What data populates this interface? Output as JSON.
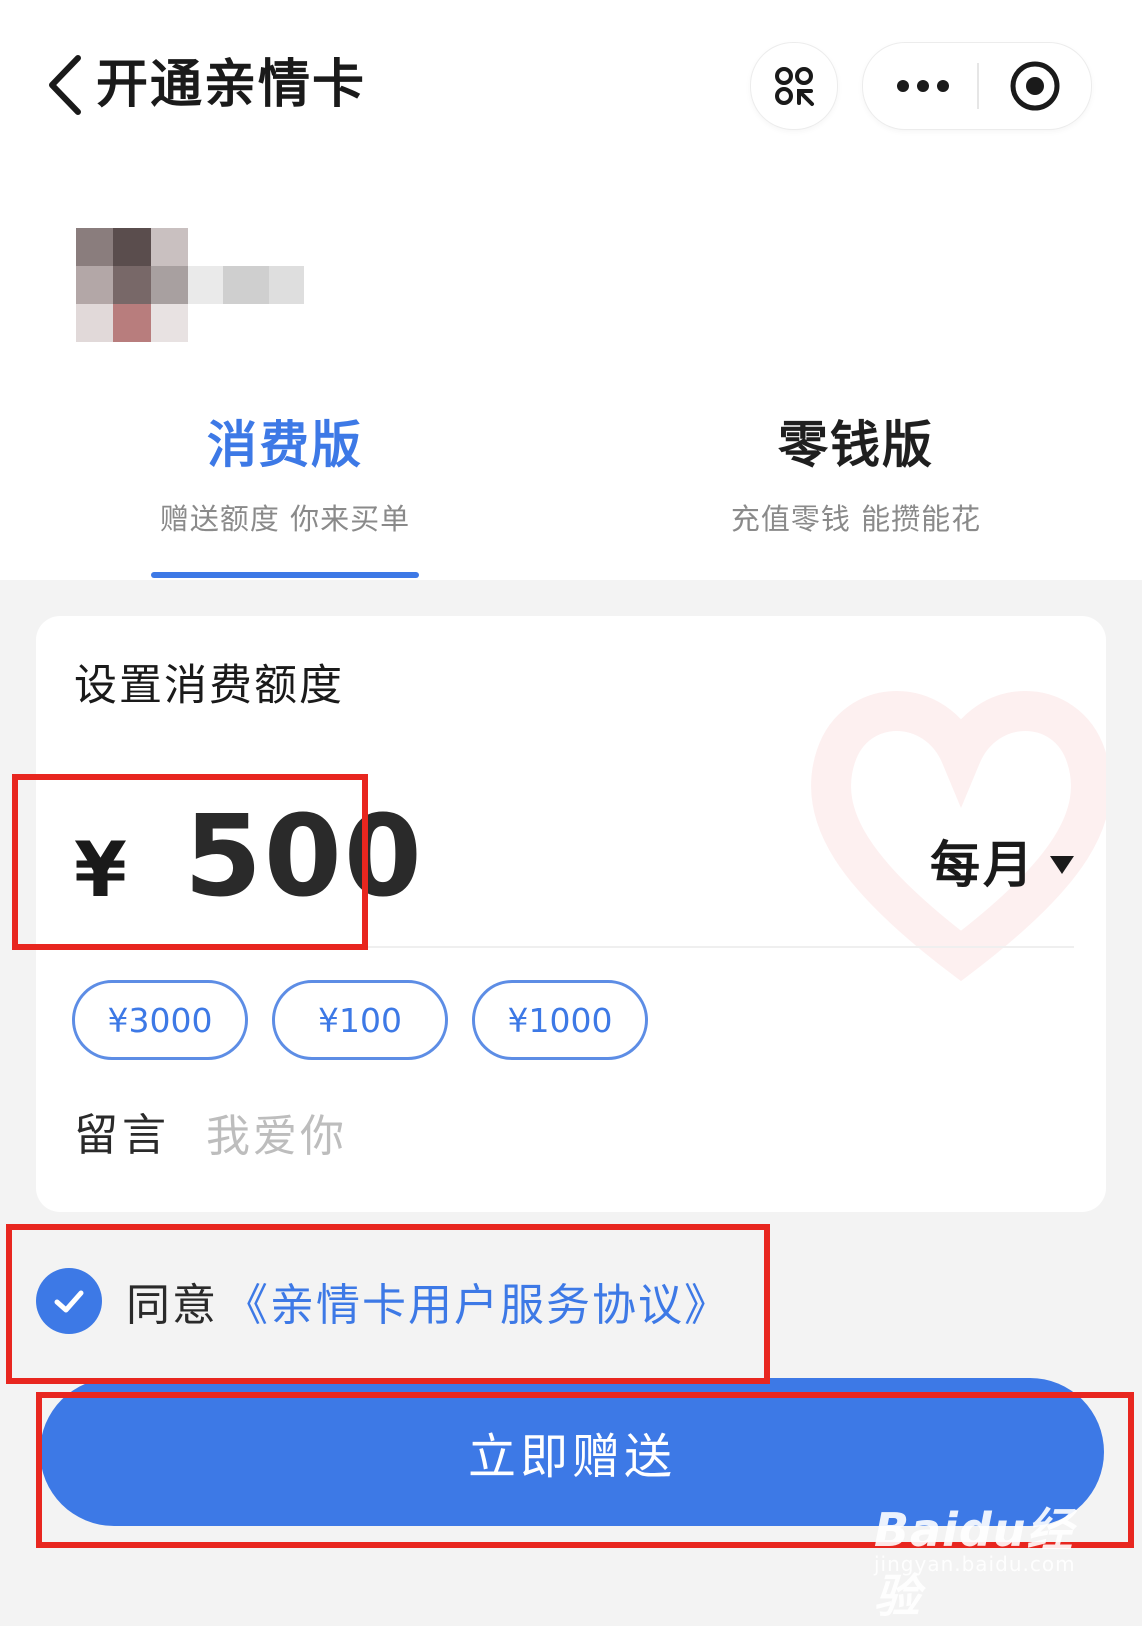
{
  "nav": {
    "title": "开通亲情卡",
    "back_icon": "chevron-left-icon",
    "scan_icon": "scan-share-icon",
    "more_icon": "more-dots-icon",
    "close_icon": "target-close-icon"
  },
  "tabs": [
    {
      "label": "消费版",
      "subtitle": "赠送额度 你来买单",
      "active": true
    },
    {
      "label": "零钱版",
      "subtitle": "充值零钱 能攒能花",
      "active": false
    }
  ],
  "card": {
    "title": "设置消费额度",
    "currency": "¥",
    "amount": "500",
    "period": "每月",
    "quick_amounts": [
      "¥3000",
      "¥100",
      "¥1000"
    ],
    "message_label": "留言",
    "message_placeholder": "我爱你"
  },
  "agreement": {
    "checked": true,
    "prefix": "同意",
    "link": "《亲情卡用户服务协议》"
  },
  "submit_label": "立即赠送",
  "watermark": {
    "logo": "Baidu经验",
    "url": "jingyan.baidu.com"
  },
  "colors": {
    "accent": "#3d79e6",
    "highlight": "#e8261f",
    "background": "#f3f3f3"
  }
}
